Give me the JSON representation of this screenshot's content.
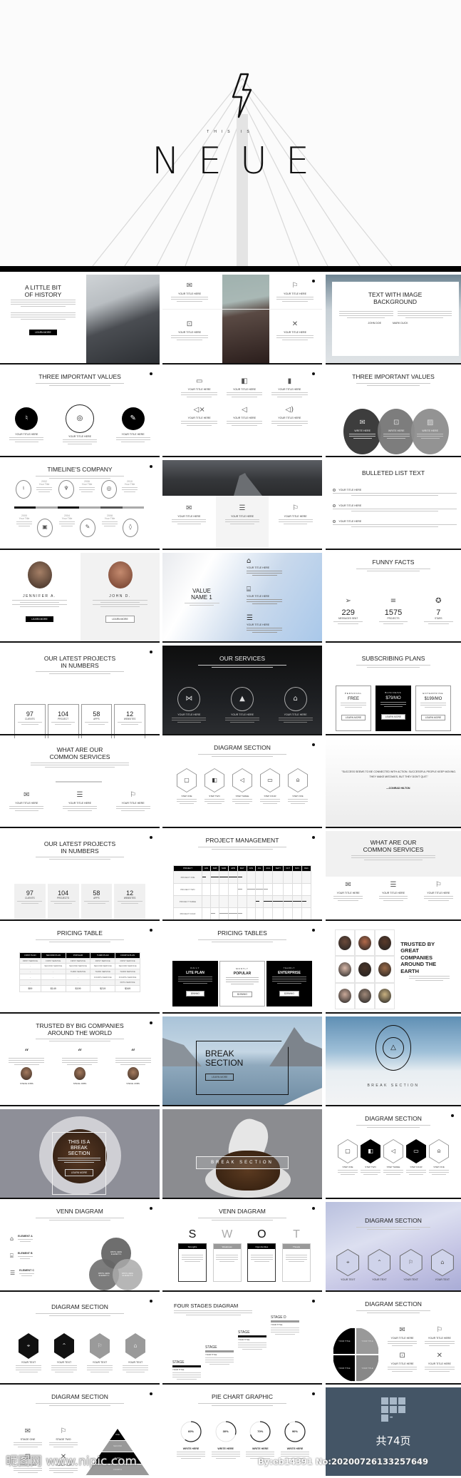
{
  "hero": {
    "icon": "lightning-bolt",
    "eyebrow": "THIS IS",
    "title": "NEUE"
  },
  "watermark": {
    "site": "昵图网 www.nipic.com",
    "id": "By:eb14391 No:20200726133257649"
  },
  "colors": {
    "dark": "#111111",
    "grey": "#8a8a8a",
    "light_grey": "#eeeeee",
    "pages_bg": "#445566"
  },
  "slides": [
    {
      "layout": "history",
      "title": "A LITTLE BIT\nOF HISTORY",
      "button": "LEARN MORE"
    },
    {
      "layout": "icons4",
      "items": [
        {
          "icon": "envelope",
          "label": "YOUR TITLE HERE"
        },
        {
          "icon": "flag",
          "label": "YOUR TITLE HERE"
        },
        {
          "icon": "camera",
          "label": "YOUR TITLE HERE"
        },
        {
          "icon": "tools",
          "label": "YOUR TITLE HERE"
        }
      ]
    },
    {
      "layout": "textbg",
      "title": "TEXT WITH IMAGE\nBACKGROUND",
      "names": [
        "JOHN DOE",
        "MARK DUCK"
      ]
    },
    {
      "layout": "values",
      "title": "THREE IMPORTANT VALUES",
      "items": [
        {
          "icon": "microphone",
          "label": "YOUR TITLE HERE"
        },
        {
          "icon": "target",
          "label": "YOUR TITLE HERE"
        },
        {
          "icon": "mic",
          "label": "YOUR TITLE HERE"
        }
      ]
    },
    {
      "layout": "grid6",
      "items": [
        {
          "icon": "battery-empty",
          "label": "YOUR TITLE HERE"
        },
        {
          "icon": "battery-half",
          "label": "YOUR TITLE HERE"
        },
        {
          "icon": "battery-full",
          "label": "YOUR TITLE HERE"
        },
        {
          "icon": "speaker-mute",
          "label": "YOUR TITLE HERE"
        },
        {
          "icon": "speaker",
          "label": "YOUR TITLE HERE"
        },
        {
          "icon": "speaker-on",
          "label": "YOUR TITLE HERE"
        }
      ]
    },
    {
      "layout": "overlap",
      "title": "THREE IMPORTANT VALUES",
      "items": [
        {
          "icon": "envelope",
          "label": "WRITE HERE"
        },
        {
          "icon": "camera",
          "label": "WRITE HERE"
        },
        {
          "icon": "image",
          "label": "WRITE HERE"
        }
      ]
    },
    {
      "layout": "timeline",
      "title": "TIMELINE'S COMPANY",
      "top": [
        {
          "year": "2002",
          "label": "Your Title"
        },
        {
          "year": "2006",
          "label": "Your Title"
        },
        {
          "year": "2010",
          "label": "Your Title"
        }
      ],
      "bottom": [
        {
          "year": "2000",
          "label": "Your Title"
        },
        {
          "year": "2004",
          "label": "Your Title"
        },
        {
          "year": "2008",
          "label": "Your Title"
        }
      ],
      "icons": [
        "microphone",
        "video",
        "trophy",
        "mic",
        "target",
        "bottle"
      ]
    },
    {
      "layout": "road",
      "items": [
        {
          "icon": "envelope",
          "label": "YOUR TITLE HERE"
        },
        {
          "icon": "chat",
          "label": "YOUR TITLE HERE"
        },
        {
          "icon": "flag",
          "label": "YOUR TITLE HERE"
        }
      ]
    },
    {
      "layout": "bullets",
      "title": "BULLETED LIST TEXT",
      "items": [
        "YOUR TITLE HERE",
        "YOUR TITLE HERE",
        "YOUR TITLE HERE"
      ]
    },
    {
      "layout": "team",
      "members": [
        {
          "name": "JENNIFER A.",
          "button": "LEARN MORE"
        },
        {
          "name": "JOHN D.",
          "button": "LEARN MORE"
        }
      ]
    },
    {
      "layout": "value",
      "title": "VALUE\nNAME 1",
      "items": [
        {
          "icon": "graduation-cap",
          "label": "YOUR TITLE HERE"
        },
        {
          "icon": "bank",
          "label": "YOUR TITLE HERE"
        },
        {
          "icon": "chat",
          "label": "YOUR TITLE HERE"
        }
      ]
    },
    {
      "layout": "facts",
      "title": "FUNNY FACTS",
      "stats": [
        {
          "icon": "paper-plane",
          "value": "229",
          "label": "MESSAGES SENT"
        },
        {
          "icon": "sliders",
          "value": "1575",
          "label": "PROJECTS"
        },
        {
          "icon": "shield-star",
          "value": "7",
          "label": "STARS"
        }
      ]
    },
    {
      "layout": "numbers",
      "style": "outline",
      "title": "OUR LATEST PROJECTS\nIN NUMBERS",
      "stats": [
        {
          "value": "97",
          "label": "CLIENTS"
        },
        {
          "value": "104",
          "label": "PROJECT"
        },
        {
          "value": "58",
          "label": "APPS"
        },
        {
          "value": "12",
          "label": "WEBSITES"
        }
      ]
    },
    {
      "layout": "services",
      "title": "OUR SERVICES",
      "items": [
        {
          "icon": "bow-tie",
          "label": "YOUR TITLE HERE"
        },
        {
          "icon": "tree",
          "label": "YOUR TITLE HERE"
        },
        {
          "icon": "graduation-cap",
          "label": "YOUR TITLE HERE"
        }
      ]
    },
    {
      "layout": "plans",
      "title": "SUBSCRIBING PLANS",
      "plans": [
        {
          "tier": "PERSONAL",
          "price": "FREE",
          "button": "LEARN MORE"
        },
        {
          "tier": "BUSINESS",
          "price": "$79/MO",
          "button": "LEARN MORE",
          "featured": true
        },
        {
          "tier": "ENTERPRISE",
          "price": "$199/MO",
          "button": "LEARN MORE"
        }
      ]
    },
    {
      "layout": "common",
      "title": "WHAT ARE OUR\nCOMMON SERVICES",
      "items": [
        {
          "icon": "envelope",
          "label": "YOUR TITLE HERE"
        },
        {
          "icon": "chat",
          "label": "YOUR TITLE HERE"
        },
        {
          "icon": "flag",
          "label": "YOUR TITLE HERE"
        }
      ]
    },
    {
      "layout": "hex5",
      "title": "DIAGRAM SECTION",
      "filled": [
        false,
        false,
        false,
        false,
        false
      ],
      "items": [
        {
          "icon": "tv",
          "label": "STEP ONE"
        },
        {
          "icon": "battery-half",
          "label": "STEP TWO"
        },
        {
          "icon": "speaker",
          "label": "STEP THREE"
        },
        {
          "icon": "monitor",
          "label": "STEP FOUR"
        },
        {
          "icon": "jar",
          "label": "STEP FIVE"
        }
      ]
    },
    {
      "layout": "quote",
      "quote": "\"SUCCESS SEEMS TO BE CONNECTED WITH ACTION. SUCCESSFUL PEOPLE KEEP MOVING. THEY MAKE MISTAKES, BUT THEY DON'T QUIT.\"",
      "author": "—CONRAD HILTON"
    },
    {
      "layout": "numbers",
      "style": "grey",
      "title": "OUR LATEST PROJECTS\nIN NUMBERS",
      "stats": [
        {
          "value": "97",
          "label": "CLIENTS"
        },
        {
          "value": "104",
          "label": "PROJECTS"
        },
        {
          "value": "58",
          "label": "APPS"
        },
        {
          "value": "12",
          "label": "WEBSITES"
        }
      ]
    },
    {
      "layout": "gantt",
      "title": "PROJECT MANAGEMENT",
      "header": "PROJECT",
      "months": [
        "JAN",
        "FEB",
        "MAR",
        "APR",
        "MAY",
        "JUN",
        "JUL",
        "AUG",
        "SEPT",
        "OCT",
        "NOV",
        "DEC"
      ],
      "projects": [
        {
          "name": "PROJECT ONE",
          "start": 1,
          "end": 5,
          "strong": true
        },
        {
          "name": "PROJECT TWO",
          "start": 5,
          "end": 8,
          "strong": false
        },
        {
          "name": "PROJECT THREE",
          "start": 7,
          "end": 12,
          "strong": true
        },
        {
          "name": "PROJECT FOUR",
          "start": 2,
          "end": 5,
          "strong": false
        }
      ]
    },
    {
      "layout": "common2",
      "title": "WHAT ARE OUR\nCOMMON SERVICES",
      "items": [
        {
          "icon": "envelope",
          "label": "YOUR TITLE HERE"
        },
        {
          "icon": "chat",
          "label": "YOUR TITLE HERE"
        },
        {
          "icon": "flag",
          "label": "YOUR TITLE HERE"
        }
      ]
    },
    {
      "layout": "ptable",
      "title": "PRICING TABLE",
      "headers": [
        "FIRST PLAN",
        "SECOND PLAN",
        "POPULAR",
        "THIRD PLAN",
        "FOURTH PLAN"
      ],
      "rows": [
        [
          "FIRST SERVICE",
          "FIRST SERVICE",
          "FIRST SERVICE",
          "FIRST SERVICE",
          "FIRST SERVICE"
        ],
        [
          "-",
          "SECOND SERVICE",
          "SECOND SERVICE",
          "SECOND SERVICE",
          "SECOND SERVICE"
        ],
        [
          "-",
          "-",
          "THIRD SERVICE",
          "THIRD SERVICE",
          "THIRD SERVICE"
        ],
        [
          "-",
          "-",
          "-",
          "FOURTH SERVICE",
          "FOURTH SERVICE"
        ],
        [
          "-",
          "-",
          "-",
          "-",
          "FIFTH SERVICE"
        ]
      ],
      "prices": [
        "$99",
        "$149",
        "$199",
        "$219",
        "$349"
      ]
    },
    {
      "layout": "ptables",
      "title": "PRICING TABLES",
      "plans": [
        {
          "period": "DAILY",
          "name": "LITE PLAN",
          "button": "$99/MO",
          "dark": true
        },
        {
          "period": "MONTLY",
          "name": "POPULAR",
          "button": "$199/MO",
          "dark": false
        },
        {
          "period": "YEARLY",
          "name": "ENTERPRISE",
          "button": "$399/MO",
          "dark": true
        }
      ]
    },
    {
      "layout": "faces",
      "title": "TRUSTED BY\nGREAT\nCOMPANIES\nAROUND THE\nEARTH"
    },
    {
      "layout": "testimonials",
      "title": "TRUSTED BY BIG COMPANIES\nAROUND THE WORLD",
      "quote_mark": "“",
      "people": [
        "STEVE JOBS",
        "STEVE JOBS",
        "STEVE JOBS"
      ]
    },
    {
      "layout": "breaklake",
      "title": "BREAK\nSECTION",
      "button": "LEARN MORE"
    },
    {
      "layout": "breakclouds",
      "title": "BREAK SECTION",
      "icon": "airplay"
    },
    {
      "layout": "breakcup",
      "title": "THIS IS A\nBREAK\nSECTION",
      "button": "LEARN MORE"
    },
    {
      "layout": "breakbeans",
      "title": "BREAK SECTION"
    },
    {
      "layout": "hex5",
      "title": "DIAGRAM SECTION",
      "filled": [
        false,
        true,
        false,
        true,
        false
      ],
      "items": [
        {
          "icon": "tv",
          "label": "STEP ONE"
        },
        {
          "icon": "battery-half",
          "label": "STEP TWO"
        },
        {
          "icon": "speaker",
          "label": "STEP THREE"
        },
        {
          "icon": "monitor",
          "label": "STEP FOUR"
        },
        {
          "icon": "jar",
          "label": "STEP FIVE"
        }
      ]
    },
    {
      "layout": "venn",
      "title": "VENN DIAGRAM",
      "elements": [
        {
          "icon": "graduation-cap",
          "label": "ELEMENT A"
        },
        {
          "icon": "bank",
          "label": "ELEMENT B"
        },
        {
          "icon": "chat",
          "label": "ELEMENT C"
        }
      ],
      "circles": [
        "WRITE HERE\nELEMENT A",
        "WRITE HERE\nELEMENT C",
        "WRITE HERE\nELEMENT B"
      ]
    },
    {
      "layout": "swot",
      "title": "VENN DIAGRAM",
      "letters": [
        "S",
        "W",
        "O",
        "T"
      ],
      "labels": [
        "Strengths",
        "Weakness",
        "Opportunities",
        "Threats"
      ]
    },
    {
      "layout": "hexsky",
      "title": "DIAGRAM SECTION",
      "items": [
        {
          "icon": "pin",
          "label": "YOUR TEXT"
        },
        {
          "icon": "chevron-up",
          "label": "YOUR TEXT"
        },
        {
          "icon": "flag",
          "label": "YOUR TEXT"
        },
        {
          "icon": "home",
          "label": "YOUR TEXT"
        }
      ]
    },
    {
      "layout": "hex4",
      "title": "DIAGRAM SECTION",
      "items": [
        {
          "icon": "pin",
          "label": "YOUR TEXT",
          "fill": "#111111"
        },
        {
          "icon": "chevron-up",
          "label": "YOUR TEXT",
          "fill": "#111111"
        },
        {
          "icon": "flag",
          "label": "YOUR TEXT",
          "fill": "#9a9a9a"
        },
        {
          "icon": "home",
          "label": "YOUR TEXT",
          "fill": "#9a9a9a"
        }
      ]
    },
    {
      "layout": "stages",
      "title": "FOUR STAGES DIAGRAM",
      "stages": [
        {
          "name": "STAGE",
          "sub": "YOUR TITLE"
        },
        {
          "name": "STAGE",
          "sub": "YOUR TITLE"
        },
        {
          "name": "STAGE",
          "sub": "YOUR TITLE"
        },
        {
          "name": "STAGE D",
          "sub": "YOUR TITLE"
        }
      ]
    },
    {
      "layout": "quad",
      "title": "DIAGRAM SECTION",
      "quadrants": [
        "YOUR TITLE",
        "YOUR TITLE",
        "YOUR TITLE",
        "YOUR TITLE"
      ],
      "items": [
        {
          "icon": "envelope",
          "label": "YOUR TITLE HERE"
        },
        {
          "icon": "flag",
          "label": "YOUR TITLE HERE"
        },
        {
          "icon": "camera",
          "label": "YOUR TITLE HERE"
        },
        {
          "icon": "tools",
          "label": "YOUR TITLE HERE"
        }
      ]
    },
    {
      "layout": "pyramid",
      "title": "DIAGRAM SECTION",
      "stages": [
        {
          "icon": "envelope",
          "label": "STAGE ONE"
        },
        {
          "icon": "flag",
          "label": "STAGE TWO"
        },
        {
          "icon": "camera",
          "label": "STAGE THREE"
        },
        {
          "icon": "tools",
          "label": "STAGE FOUR"
        }
      ],
      "levels": [
        "ONE",
        "SECOND",
        "THIRD",
        "FOURTH"
      ]
    },
    {
      "layout": "pies",
      "title": "PIE CHART GRAPHIC",
      "pies": [
        {
          "percent": 60,
          "text": "60%",
          "label": "WRITE HERE"
        },
        {
          "percent": 30,
          "text": "30%",
          "label": "WRITE HERE"
        },
        {
          "percent": 70,
          "text": "70%",
          "label": "WRITE HERE"
        },
        {
          "percent": 90,
          "text": "90%",
          "label": "WRITE HERE"
        }
      ]
    },
    {
      "layout": "pages",
      "icon": "grid-more",
      "text": "共74页"
    }
  ]
}
